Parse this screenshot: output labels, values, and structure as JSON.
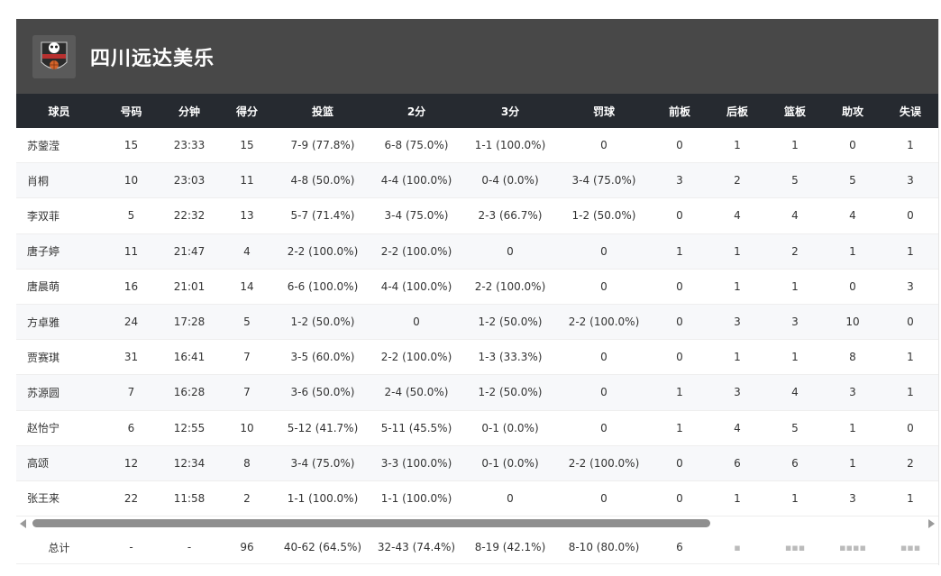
{
  "header": {
    "team_name": "四川远达美乐"
  },
  "table": {
    "columns": [
      "球员",
      "号码",
      "分钟",
      "得分",
      "投篮",
      "2分",
      "3分",
      "罚球",
      "前板",
      "后板",
      "篮板",
      "助攻",
      "失误"
    ],
    "rows": [
      [
        "苏蓥滢",
        "15",
        "23:33",
        "15",
        "7-9 (77.8%)",
        "6-8 (75.0%)",
        "1-1 (100.0%)",
        "0",
        "0",
        "1",
        "1",
        "0",
        "1"
      ],
      [
        "肖桐",
        "10",
        "23:03",
        "11",
        "4-8 (50.0%)",
        "4-4 (100.0%)",
        "0-4 (0.0%)",
        "3-4 (75.0%)",
        "3",
        "2",
        "5",
        "5",
        "3"
      ],
      [
        "李双菲",
        "5",
        "22:32",
        "13",
        "5-7 (71.4%)",
        "3-4 (75.0%)",
        "2-3 (66.7%)",
        "1-2 (50.0%)",
        "0",
        "4",
        "4",
        "4",
        "0"
      ],
      [
        "唐子婷",
        "11",
        "21:47",
        "4",
        "2-2 (100.0%)",
        "2-2 (100.0%)",
        "0",
        "0",
        "1",
        "1",
        "2",
        "1",
        "1"
      ],
      [
        "唐晨萌",
        "16",
        "21:01",
        "14",
        "6-6 (100.0%)",
        "4-4 (100.0%)",
        "2-2 (100.0%)",
        "0",
        "0",
        "1",
        "1",
        "0",
        "3"
      ],
      [
        "方卓雅",
        "24",
        "17:28",
        "5",
        "1-2 (50.0%)",
        "0",
        "1-2 (50.0%)",
        "2-2 (100.0%)",
        "0",
        "3",
        "3",
        "10",
        "0"
      ],
      [
        "贾赛琪",
        "31",
        "16:41",
        "7",
        "3-5 (60.0%)",
        "2-2 (100.0%)",
        "1-3 (33.3%)",
        "0",
        "0",
        "1",
        "1",
        "8",
        "1"
      ],
      [
        "苏源圆",
        "7",
        "16:28",
        "7",
        "3-6 (50.0%)",
        "2-4 (50.0%)",
        "1-2 (50.0%)",
        "0",
        "1",
        "3",
        "4",
        "3",
        "1"
      ],
      [
        "赵怡宁",
        "6",
        "12:55",
        "10",
        "5-12 (41.7%)",
        "5-11 (45.5%)",
        "0-1 (0.0%)",
        "0",
        "1",
        "4",
        "5",
        "1",
        "0"
      ],
      [
        "高颂",
        "12",
        "12:34",
        "8",
        "3-4 (75.0%)",
        "3-3 (100.0%)",
        "0-1 (0.0%)",
        "2-2 (100.0%)",
        "0",
        "6",
        "6",
        "1",
        "2"
      ],
      [
        "张王来",
        "22",
        "11:58",
        "2",
        "1-1 (100.0%)",
        "1-1 (100.0%)",
        "0",
        "0",
        "0",
        "1",
        "1",
        "3",
        "1"
      ]
    ],
    "totals": [
      "总计",
      "-",
      "-",
      "96",
      "40-62 (64.5%)",
      "32-43 (74.4%)",
      "8-19 (42.1%)",
      "8-10 (80.0%)",
      "6"
    ]
  },
  "colors": {
    "header_bg": "#484848",
    "table_header_bg": "#262a30",
    "row_alt_bg": "#f7f8fa"
  }
}
